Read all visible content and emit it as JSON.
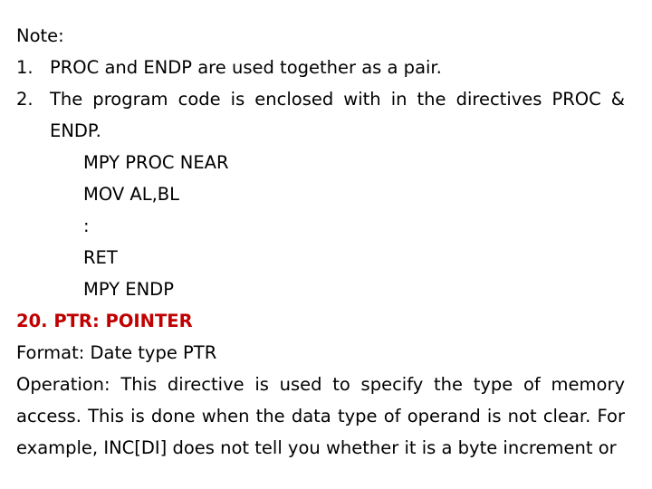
{
  "slide": {
    "background_color": "#FFFFFF",
    "text_color": "#000000",
    "accent_color": "#C00000",
    "note_heading": "Note:",
    "numbered_list": [
      {
        "marker": "1.",
        "text": "PROC and ENDP are used together as a pair."
      },
      {
        "marker": "2.",
        "text": "The program code is enclosed with in the directives PROC & ENDP."
      }
    ],
    "code_block": [
      "MPY PROC NEAR",
      "MOV AL,BL",
      ":",
      "RET",
      "MPY ENDP"
    ],
    "section_heading": "20. PTR: POINTER",
    "format_line": "Format: Date type PTR",
    "operation_paragraph": "Operation: This directive is used to specify the type of memory access. This is done when the data type of operand is not clear. For example, INC[DI] does not tell you whether it is a byte increment or"
  }
}
